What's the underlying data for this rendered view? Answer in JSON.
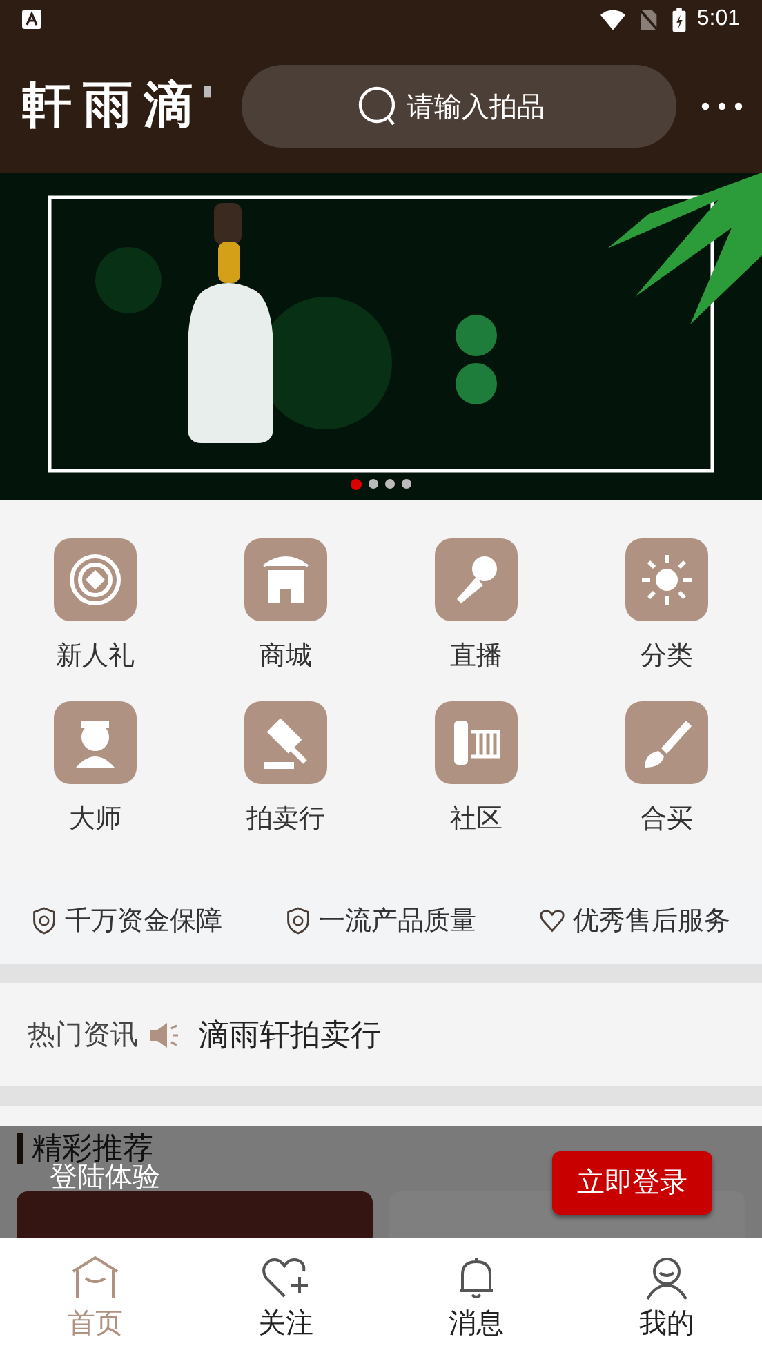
{
  "status_bar": {
    "time": "5:01"
  },
  "header": {
    "logo": "軒雨滴",
    "search": {
      "placeholder": "请输入拍品"
    }
  },
  "banner": {
    "slides": [
      {
        "selected": true
      },
      {
        "selected": false
      },
      {
        "selected": false
      },
      {
        "selected": false
      }
    ]
  },
  "categories": [
    {
      "label": "新人礼"
    },
    {
      "label": "商城"
    },
    {
      "label": "直播"
    },
    {
      "label": "分类"
    },
    {
      "label": "大师"
    },
    {
      "label": "拍卖行"
    },
    {
      "label": "社区"
    },
    {
      "label": "合买"
    }
  ],
  "guarantees": [
    "千万资金保障",
    "一流产品质量",
    "优秀售后服务"
  ],
  "news": {
    "label": "热门资讯",
    "headline": "滴雨轩拍卖行"
  },
  "featured": {
    "title": "精彩推荐"
  },
  "login_prompt": {
    "text": "登陆体验",
    "button": "立即登录"
  },
  "bottom_nav": [
    {
      "label": "首页",
      "selected": true
    },
    {
      "label": "关注",
      "selected": false
    },
    {
      "label": "消息",
      "selected": false
    },
    {
      "label": "我的",
      "selected": false
    }
  ]
}
